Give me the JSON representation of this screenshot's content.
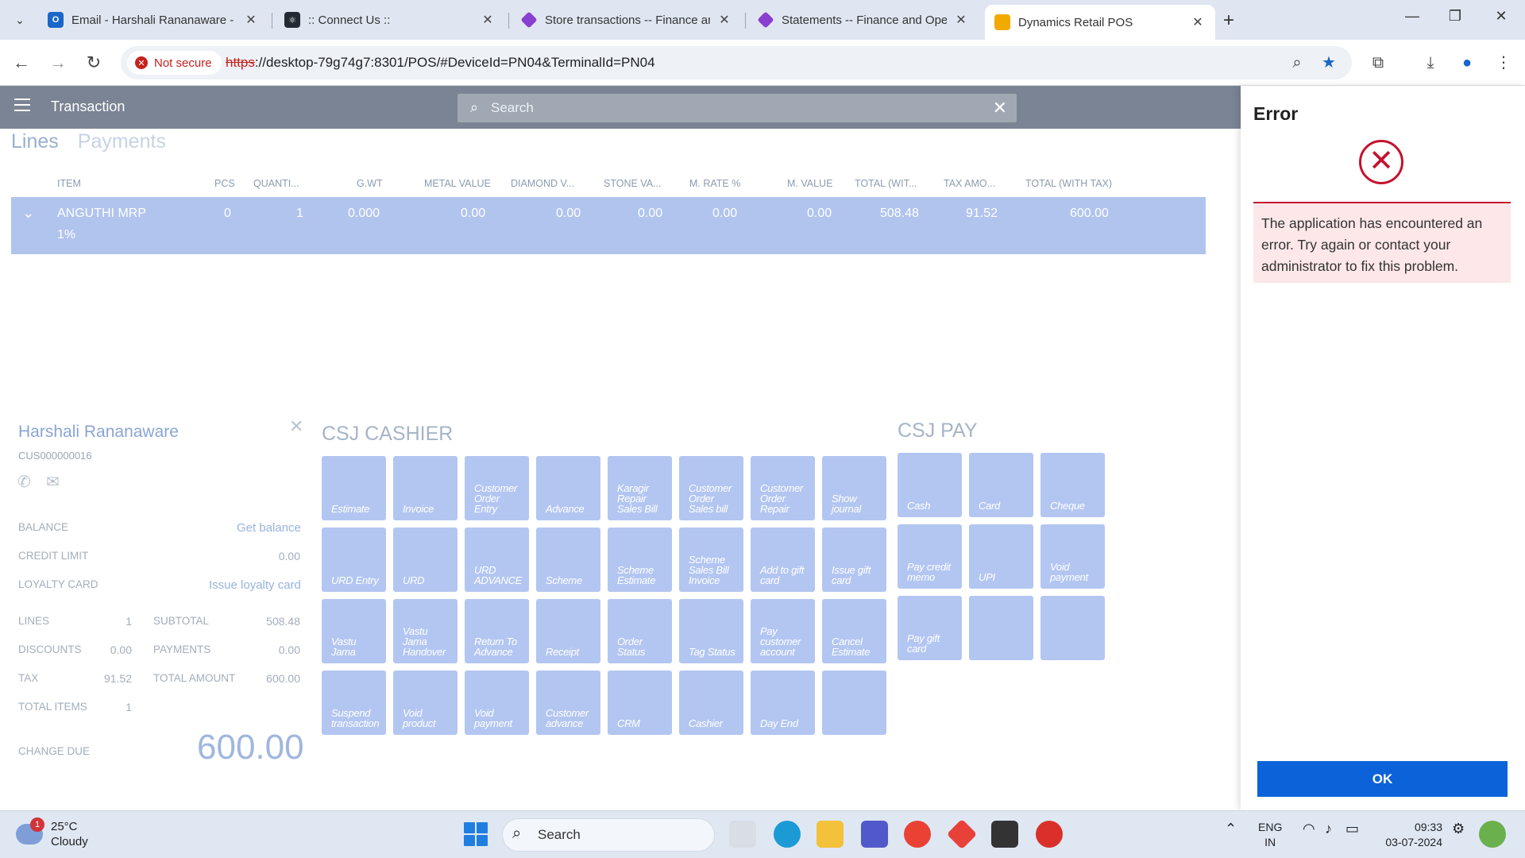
{
  "browser": {
    "tabs": [
      {
        "title": "Email - Harshali Rananaware - C",
        "icon": "outlook-icon",
        "color": "#1a66c9"
      },
      {
        "title": ":: Connect Us ::",
        "icon": "react-icon",
        "color": "#222a33"
      },
      {
        "title": "Store transactions -- Finance an",
        "icon": "dynamics-icon",
        "color": "#8a3fd1"
      },
      {
        "title": "Statements -- Finance and Ope",
        "icon": "dynamics-icon",
        "color": "#8a3fd1"
      },
      {
        "title": "Dynamics Retail POS",
        "icon": "pos-icon",
        "color": "#f2a900"
      }
    ],
    "not_secure": "Not secure",
    "url_proto": "https",
    "url_rest": "://desktop-79g74g7:8301/POS/#DeviceId=PN04&TerminalId=PN04"
  },
  "app": {
    "title": "Transaction",
    "search_placeholder": "Search",
    "tabs": [
      "Lines",
      "Payments"
    ],
    "columns": [
      "ITEM",
      "PCS",
      "QUANTI...",
      "G.WT",
      "METAL VALUE",
      "DIAMOND V...",
      "STONE VA...",
      "M. RATE %",
      "M. VALUE",
      "TOTAL (WIT...",
      "TAX AMO...",
      "TOTAL (WITH TAX)"
    ],
    "row": {
      "item": "ANGUTHI MRP",
      "sub": "1%",
      "pcs": "0",
      "qty": "1",
      "gwt": "0.000",
      "metal": "0.00",
      "diamond": "0.00",
      "stone": "0.00",
      "mrate": "0.00",
      "mvalue": "0.00",
      "total_wo": "508.48",
      "tax": "91.52",
      "total": "600.00"
    }
  },
  "customer": {
    "name": "Harshali Rananaware",
    "id": "CUS000000016",
    "balance_label": "BALANCE",
    "balance_link": "Get balance",
    "credit_label": "CREDIT LIMIT",
    "credit_value": "0.00",
    "loyalty_label": "LOYALTY CARD",
    "loyalty_link": "Issue loyalty card",
    "lines_label": "LINES",
    "lines_value": "1",
    "subtotal_label": "SUBTOTAL",
    "subtotal_value": "508.48",
    "discounts_label": "DISCOUNTS",
    "discounts_value": "0.00",
    "payments_label": "PAYMENTS",
    "payments_value": "0.00",
    "tax_label": "TAX",
    "tax_value": "91.52",
    "total_amount_label": "TOTAL AMOUNT",
    "total_amount_value": "600.00",
    "total_items_label": "TOTAL ITEMS",
    "total_items_value": "1",
    "change_label": "CHANGE DUE",
    "change_value": "600.00"
  },
  "cashier": {
    "title": "CSJ CASHIER",
    "buttons": [
      "Estimate",
      "Invoice",
      "Customer Order Entry",
      "Advance",
      "Karagir Repair Sales Bill",
      "Customer Order Sales bill",
      "Customer Order Repair",
      "Show journal",
      "URD Entry",
      "URD",
      "URD ADVANCE",
      "Scheme",
      "Scheme Estimate",
      "Scheme Sales Bill Invoice",
      "Add to gift card",
      "Issue gift card",
      "Vastu Jama",
      "Vastu Jama Handover",
      "Return To Advance",
      "Receipt",
      "Order Status",
      "Tag Status",
      "Pay customer account",
      "Cancel Estimate",
      "Suspend transaction",
      "Void product",
      "Void payment",
      "Customer advance",
      "CRM",
      "Cashier",
      "Day End",
      ""
    ]
  },
  "pay": {
    "title": "CSJ PAY",
    "buttons": [
      "Cash",
      "Card",
      "Cheque",
      "Pay credit memo",
      "UPI",
      "Void payment",
      "Pay gift card",
      "",
      ""
    ]
  },
  "dialog": {
    "title": "Error",
    "message": "The application has encountered an error. Try again or contact your administrator to fix this problem.",
    "ok": "OK"
  },
  "taskbar": {
    "weather_badge": "1",
    "temp": "25°C",
    "condition": "Cloudy",
    "search": "Search",
    "lang1": "ENG",
    "lang2": "IN",
    "time": "09:33",
    "date": "03-07-2024"
  }
}
